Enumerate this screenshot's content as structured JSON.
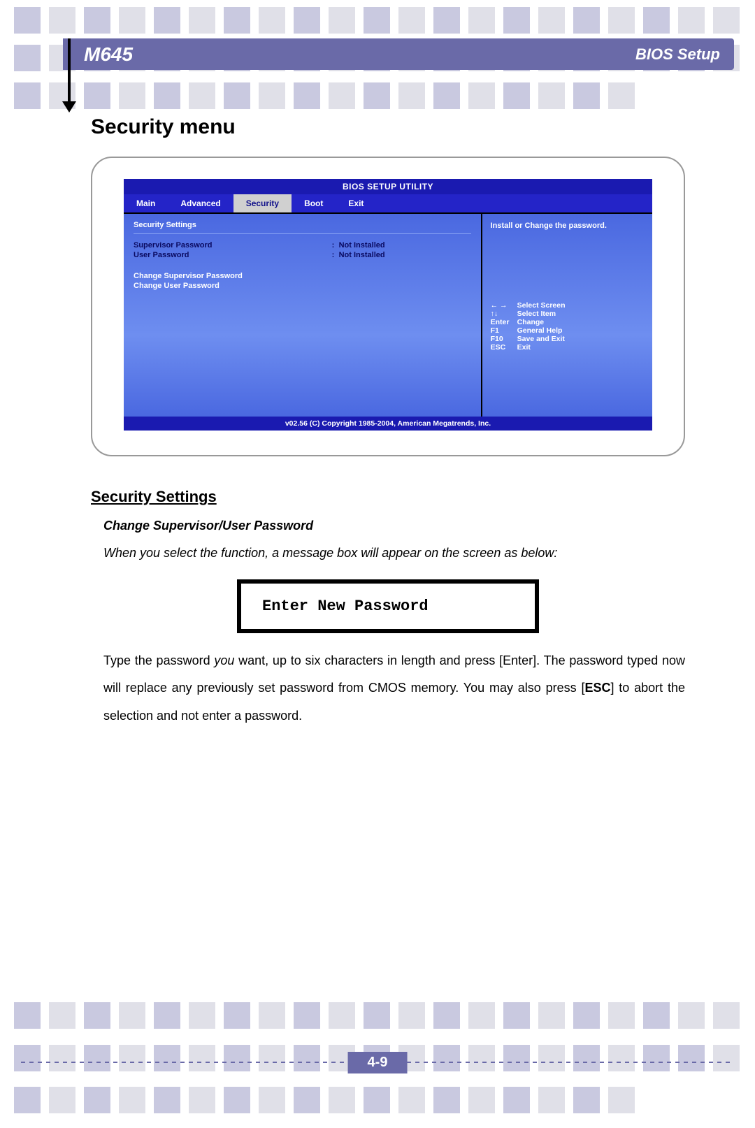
{
  "header": {
    "model": "M645",
    "section": "BIOS Setup"
  },
  "page_title": "Security menu",
  "bios": {
    "title": "BIOS SETUP UTILITY",
    "tabs": [
      "Main",
      "Advanced",
      "Security",
      "Boot",
      "Exit"
    ],
    "active_tab": "Security",
    "panel_heading": "Security Settings",
    "rows": [
      {
        "k": "Supervisor Password",
        "v": "Not Installed"
      },
      {
        "k": "User Password",
        "v": "Not Installed"
      }
    ],
    "links": [
      "Change Supervisor Password",
      "Change User Password"
    ],
    "help": "Install or Change the password.",
    "keys": [
      {
        "k": "← →",
        "v": "Select Screen"
      },
      {
        "k": "↑↓",
        "v": "Select Item"
      },
      {
        "k": "Enter",
        "v": "Change"
      },
      {
        "k": "F1",
        "v": "General Help"
      },
      {
        "k": "F10",
        "v": "Save and Exit"
      },
      {
        "k": "ESC",
        "v": "Exit"
      }
    ],
    "footer": "v02.56 (C) Copyright 1985-2004, American Megatrends, Inc."
  },
  "section_heading": "Security Settings",
  "sub_heading": "Change Supervisor/User Password",
  "para1": "When you select the function, a message box will appear on the screen as below:",
  "password_box": "Enter New Password",
  "para2_a": "Type the password ",
  "para2_you": "you",
  "para2_b": " want, up to six characters in length and press [Enter].   The password typed now will replace any previously set password from CMOS memory. You may also press [",
  "para2_esc": "ESC",
  "para2_c": "] to abort the selection and not enter a password.",
  "page_number": "4-9"
}
